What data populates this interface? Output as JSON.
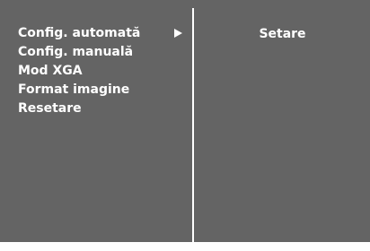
{
  "menu": {
    "items": [
      {
        "label": "Config. automată",
        "selected": true
      },
      {
        "label": "Config. manuală",
        "selected": false
      },
      {
        "label": "Mod XGA",
        "selected": false
      },
      {
        "label": "Format imagine",
        "selected": false
      },
      {
        "label": "Resetare",
        "selected": false
      }
    ],
    "arrow_icon": "triangle-right-icon"
  },
  "submenu": {
    "label": "Setare"
  },
  "colors": {
    "panel_bg": "#646464",
    "text": "#ffffff",
    "divider": "#ffffff"
  }
}
